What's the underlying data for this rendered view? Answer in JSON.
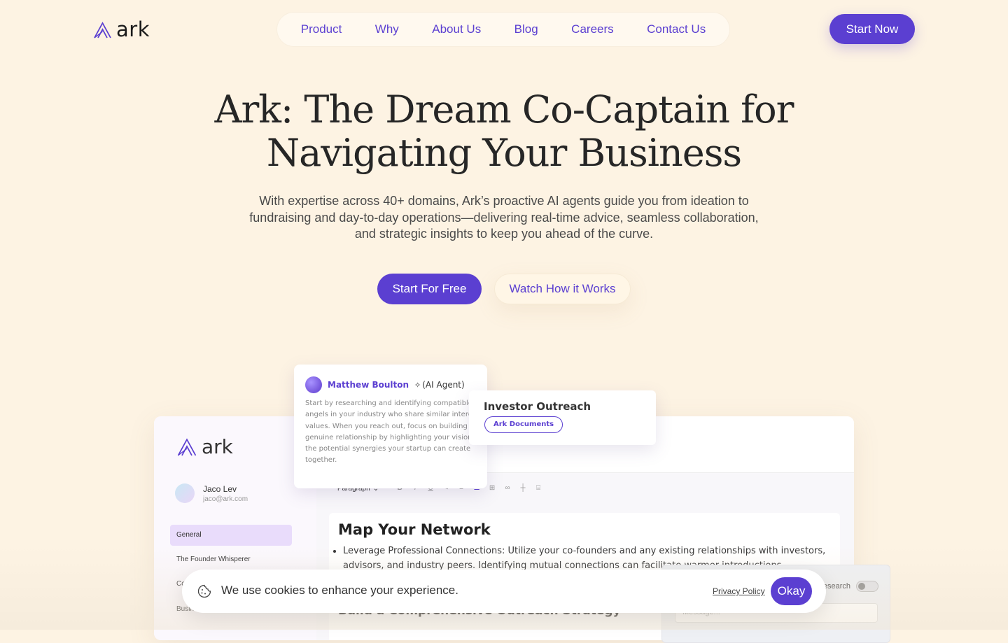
{
  "brand": {
    "name": "ark",
    "accent": "#5b3fd1",
    "background": "#fdf3e3"
  },
  "nav": {
    "items": [
      {
        "label": "Product"
      },
      {
        "label": "Why"
      },
      {
        "label": "About Us"
      },
      {
        "label": "Blog"
      },
      {
        "label": "Careers"
      },
      {
        "label": "Contact Us"
      }
    ],
    "cta": "Start Now"
  },
  "hero": {
    "title_line1": "Ark: The Dream Co-Captain for",
    "title_line2": "Navigating Your Business",
    "subtitle": "With expertise across 40+ domains, Ark’s proactive AI agents guide you from ideation to fundraising and day-to-day operations—delivering real-time advice, seamless collaboration, and strategic insights to keep you ahead of the curve.",
    "primary_cta": "Start For Free",
    "secondary_cta": "Watch How it Works"
  },
  "app_preview": {
    "logo": "ark",
    "user": {
      "name": "Jaco Lev",
      "email": "jaco@ark.com"
    },
    "sidebar": [
      {
        "label": "General",
        "active": true
      },
      {
        "label": "The Founder Whisperer"
      },
      {
        "label": "Co"
      },
      {
        "label": "Busin"
      }
    ],
    "toolbar": {
      "block_type": "Paragraph"
    },
    "doc": {
      "heading": "Map Your Network",
      "bullet": "Leverage Professional Connections: Utilize your co-founders and any existing relationships with investors, advisors, and industry peers. Identifying mutual connections can facilitate warmer introductions.",
      "heading2": "Build a Comprehensive Outreach Strategy"
    },
    "chat": {
      "toggle_label": "esearch",
      "message_placeholder": "Message..."
    },
    "agent_card": {
      "name": "Matthew Boulton",
      "tag": "(AI Agent)",
      "text": "Start by researching and identifying compatible angels in your industry who share similar interests or values. When you reach out, focus on building a genuine relationship by highlighting your vision and the potential synergies your startup can create together."
    },
    "outreach_card": {
      "title": "Investor Outreach",
      "tag": "Ark Documents"
    }
  },
  "cookie": {
    "text": "We use cookies to enhance your experience.",
    "link": "Privacy Policy",
    "button": "Okay"
  }
}
